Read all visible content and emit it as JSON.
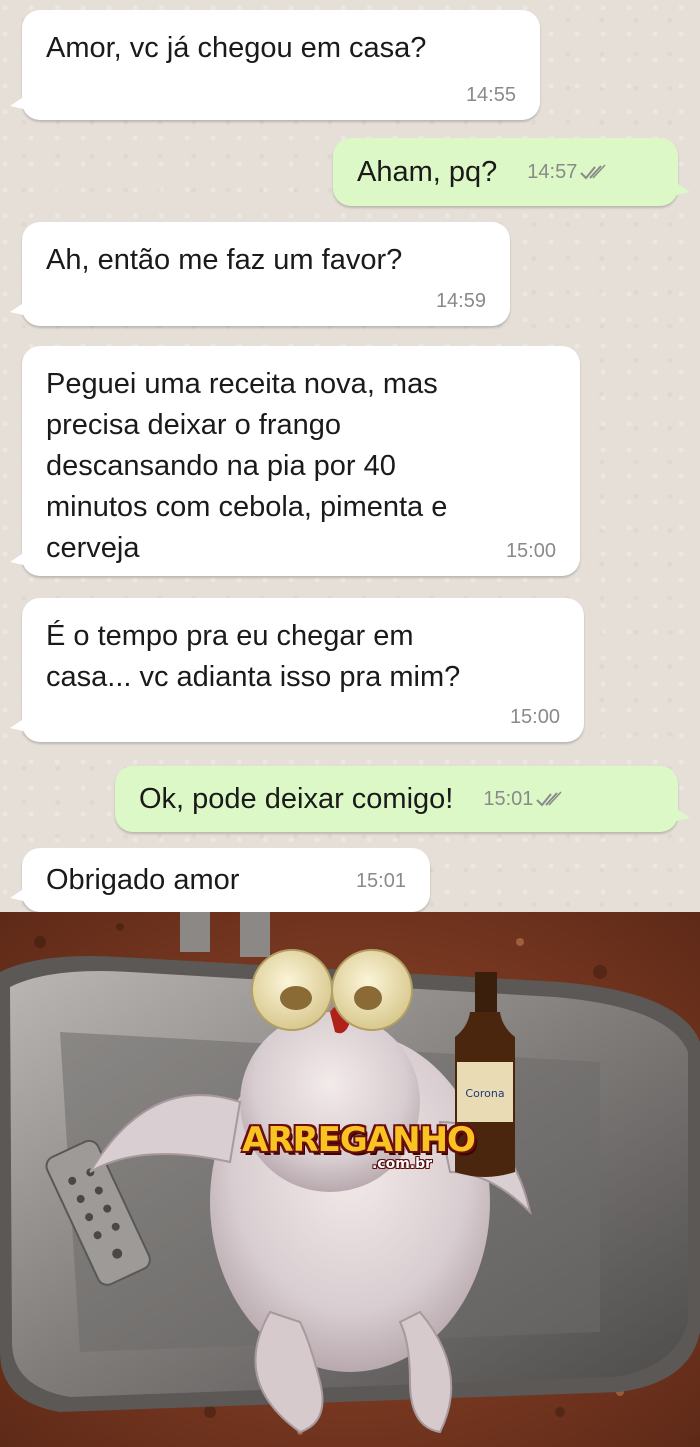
{
  "messages": [
    {
      "direction": "in",
      "text": "Amor, vc já chegou em casa?",
      "time": "14:55"
    },
    {
      "direction": "out",
      "text": "Aham, pq?",
      "time": "14:57"
    },
    {
      "direction": "in",
      "text": "Ah, então me faz um favor?",
      "time": "14:59"
    },
    {
      "direction": "in",
      "text": "Peguei uma receita nova, mas\nprecisa deixar o frango\ndescansando na pia por 40\nminutos com cebola, pimenta e\ncerveja",
      "time": "15:00"
    },
    {
      "direction": "in",
      "text": "É o tempo pra eu chegar em\ncasa... vc adianta isso pra mim?",
      "time": "15:00"
    },
    {
      "direction": "out",
      "text": "Ok, pode deixar comigo!",
      "time": "15:01"
    },
    {
      "direction": "in",
      "text": "Obrigado amor",
      "time": "15:01"
    }
  ],
  "photo": {
    "watermark": "ARREGANHO",
    "watermark_domain": ".com.br",
    "bottle_label": "Corona"
  },
  "colors": {
    "incoming_bubble": "#ffffff",
    "outgoing_bubble": "#dcf8c6",
    "chat_background": "#e5dfd8",
    "timestamp": "#8a8a8a",
    "read_ticks": "#8a8a8a"
  }
}
